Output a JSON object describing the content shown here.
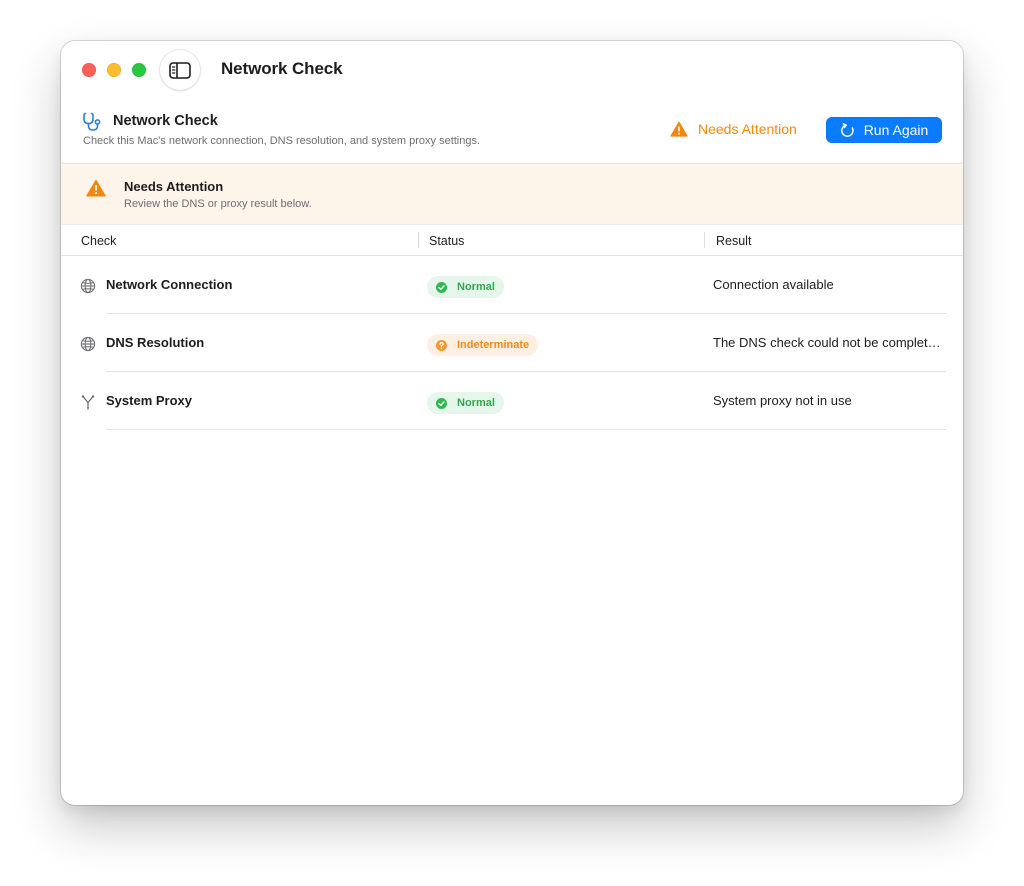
{
  "window": {
    "title": "Network Check"
  },
  "header": {
    "icon": "stethoscope-icon",
    "title": "Network Check",
    "subtitle": "Check this Mac's network connection, DNS resolution, and system proxy settings.",
    "status_label": "Needs Attention",
    "status_icon": "warning-icon",
    "run_button_label": "Run Again",
    "run_button_icon": "refresh-icon"
  },
  "banner": {
    "icon": "warning-icon",
    "title": "Needs Attention",
    "subtitle": "Review the DNS or proxy result below."
  },
  "table": {
    "columns": [
      "Check",
      "Status",
      "Result"
    ],
    "rows": [
      {
        "icon": "globe-icon",
        "name": "Network Connection",
        "status": "Normal",
        "status_kind": "normal",
        "result": "Connection available"
      },
      {
        "icon": "globe-icon",
        "name": "DNS Resolution",
        "status": "Indeterminate",
        "status_kind": "indeterminate",
        "result": "The DNS check could not be completed."
      },
      {
        "icon": "branch-icon",
        "name": "System Proxy",
        "status": "Normal",
        "status_kind": "normal",
        "result": "System proxy not in use"
      }
    ]
  },
  "colors": {
    "accent": "#0a7cff",
    "warning": "#f0880f",
    "success": "#2fa84f",
    "banner_background": "#fdf4ea",
    "close": "#fe5f57",
    "minimize": "#febc2e",
    "zoom": "#28c840"
  }
}
